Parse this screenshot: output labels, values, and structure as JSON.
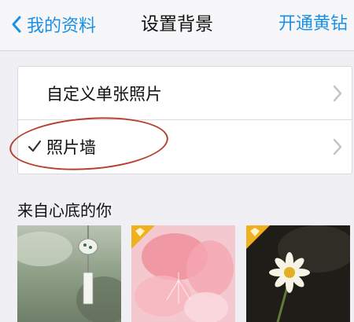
{
  "nav": {
    "back_label": "我的资料",
    "title": "设置背景",
    "right_action": "开通黄钻"
  },
  "options": [
    {
      "label": "自定义单张照片",
      "selected": false
    },
    {
      "label": "照片墙",
      "selected": true
    }
  ],
  "section": {
    "title": "来自心底的你"
  },
  "thumbnails": [
    {
      "subject": "wind-chime",
      "premium": false
    },
    {
      "subject": "pink-petals",
      "premium": true
    },
    {
      "subject": "daisy-flower",
      "premium": true
    }
  ],
  "colors": {
    "accent": "#1a8fe6",
    "annotation": "#b5402c",
    "premium_badge": "#f0b020"
  },
  "icons": [
    "back-chevron-icon",
    "chevron-right-icon",
    "checkmark-icon",
    "diamond-icon"
  ]
}
